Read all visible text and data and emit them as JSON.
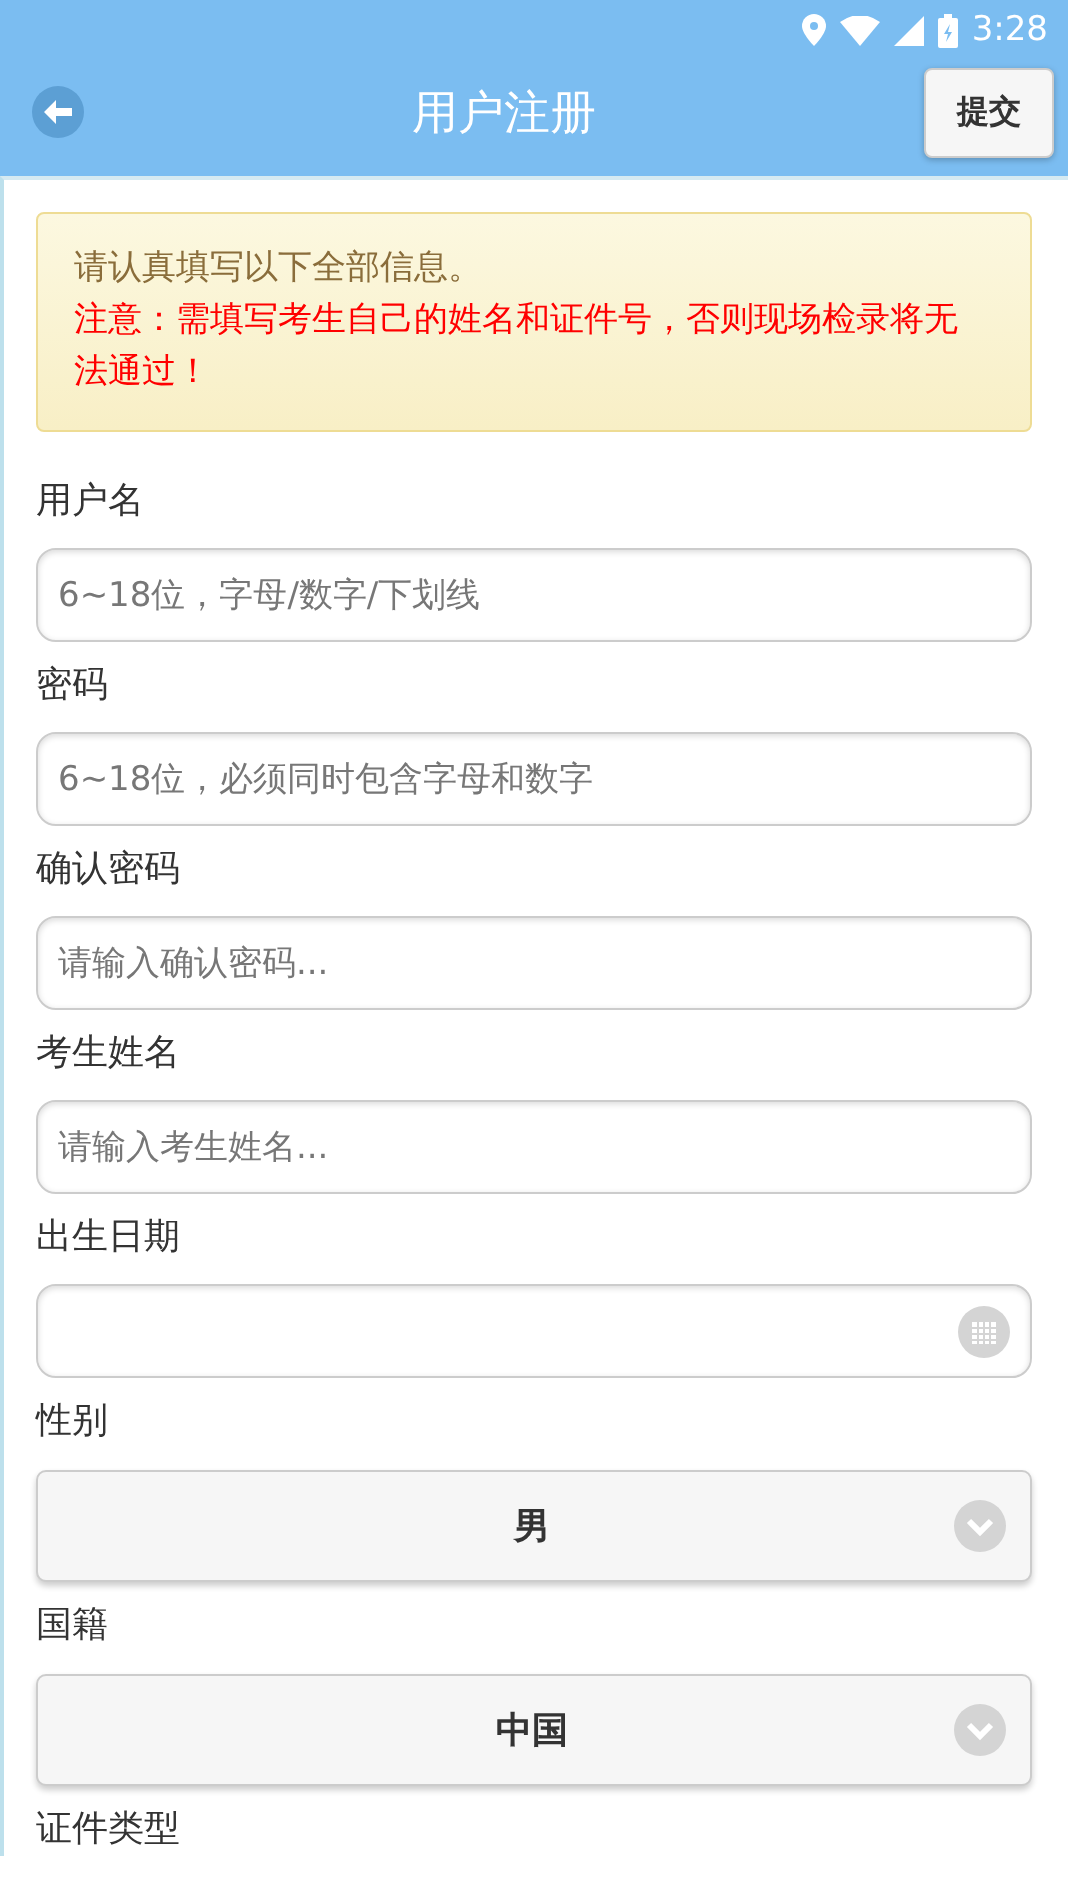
{
  "status_bar": {
    "time": "3:28"
  },
  "header": {
    "title": "用户注册",
    "submit": "提交"
  },
  "notice": {
    "info": "请认真填写以下全部信息。",
    "warning": "注意：需填写考生自己的姓名和证件号，否则现场检录将无法通过！"
  },
  "fields": [
    {
      "kind": "text",
      "label": "用户名",
      "placeholder": "6~18位，字母/数字/下划线"
    },
    {
      "kind": "text",
      "label": "密码",
      "placeholder": "6~18位，必须同时包含字母和数字"
    },
    {
      "kind": "text",
      "label": "确认密码",
      "placeholder": "请输入确认密码..."
    },
    {
      "kind": "text",
      "label": "考生姓名",
      "placeholder": "请输入考生姓名..."
    },
    {
      "kind": "date",
      "label": "出生日期"
    },
    {
      "kind": "select",
      "label": "性别",
      "value": "男"
    },
    {
      "kind": "select",
      "label": "国籍",
      "value": "中国"
    },
    {
      "kind": "label",
      "label": "证件类型"
    }
  ]
}
